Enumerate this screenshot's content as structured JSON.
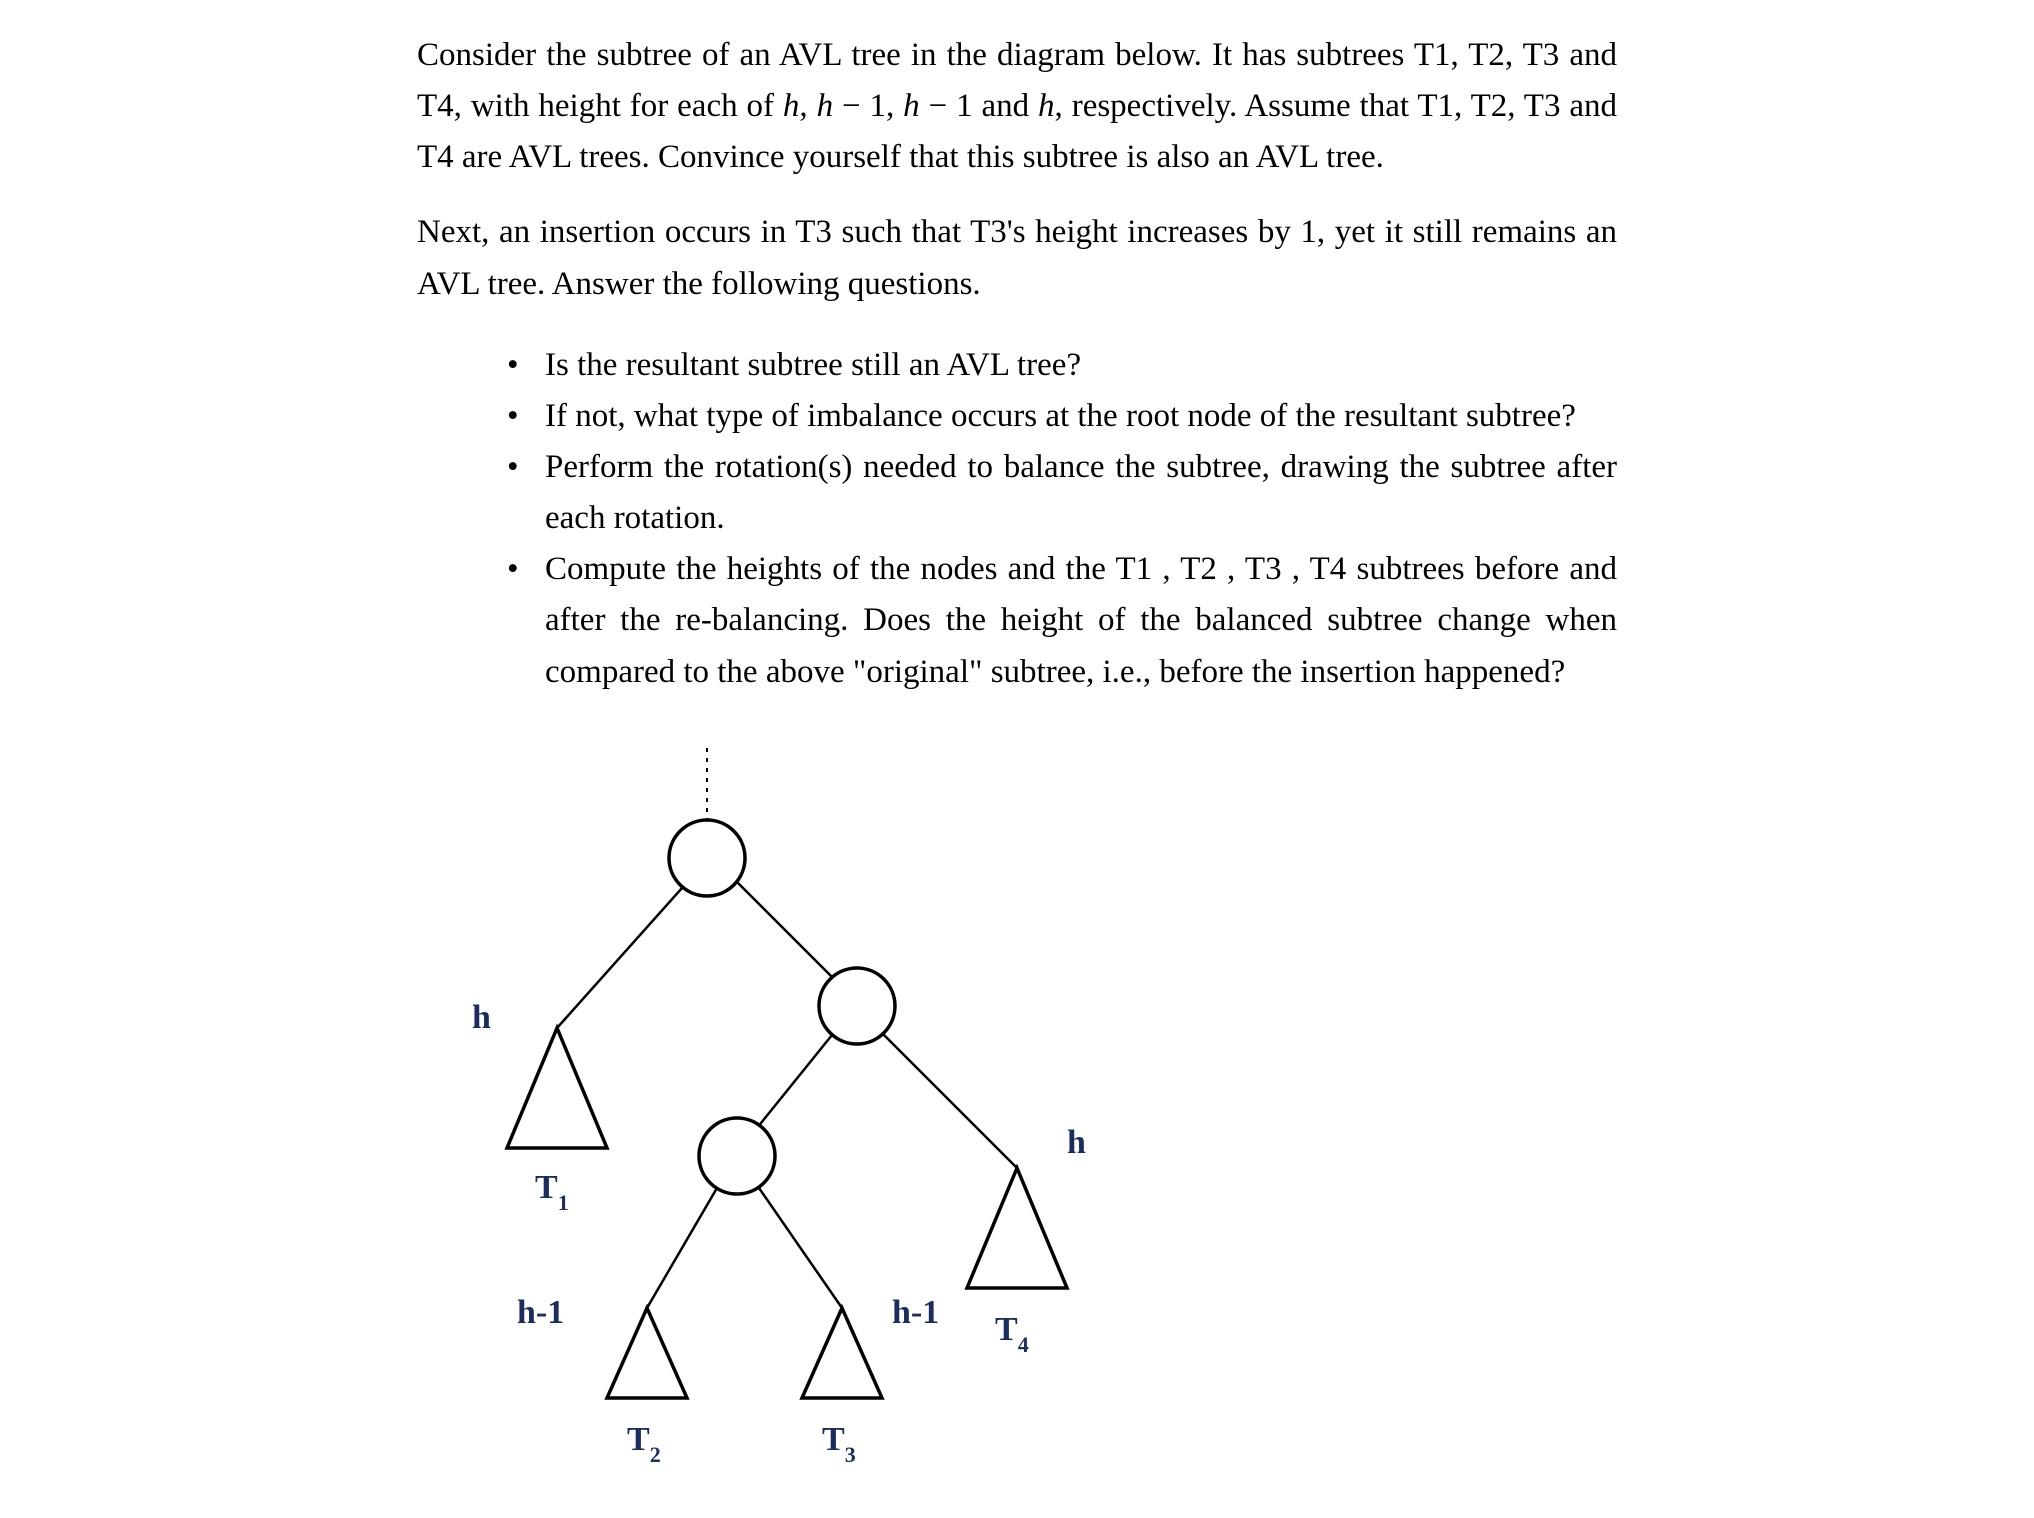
{
  "paragraphs": {
    "p1": "Consider the subtree of an AVL tree in the diagram below. It has subtrees T1, T2, T3 and T4, with height for each of h, h − 1, h − 1 and h, respectively. Assume that T1, T2, T3 and T4 are AVL trees. Convince yourself that this subtree is also an AVL tree.",
    "p2": "Next, an insertion occurs in T3 such that T3's height increases by 1, yet it still remains an AVL tree. Answer the following questions."
  },
  "bullets": {
    "b1": "Is the resultant subtree still an AVL tree?",
    "b2": "If not, what type of imbalance occurs at the root node of the resultant subtree?",
    "b3": "Perform the rotation(s) needed to balance the subtree, drawing the subtree after each rotation.",
    "b4": "Compute the heights of the nodes and the T1 , T2 , T3 , T4 subtrees before and after the re-balancing. Does the height of the balanced subtree change when compared to the above \"original\" subtree, i.e., before the insertion happened?"
  },
  "diagram": {
    "labels": {
      "t1_height": "h",
      "t1_name_main": "T",
      "t1_name_sub": "1",
      "t2_height": "h-1",
      "t2_name_main": "T",
      "t2_name_sub": "2",
      "t3_height": "h-1",
      "t3_name_main": "T",
      "t3_name_sub": "3",
      "t4_height": "h",
      "t4_name_main": "T",
      "t4_name_sub": "4"
    }
  }
}
